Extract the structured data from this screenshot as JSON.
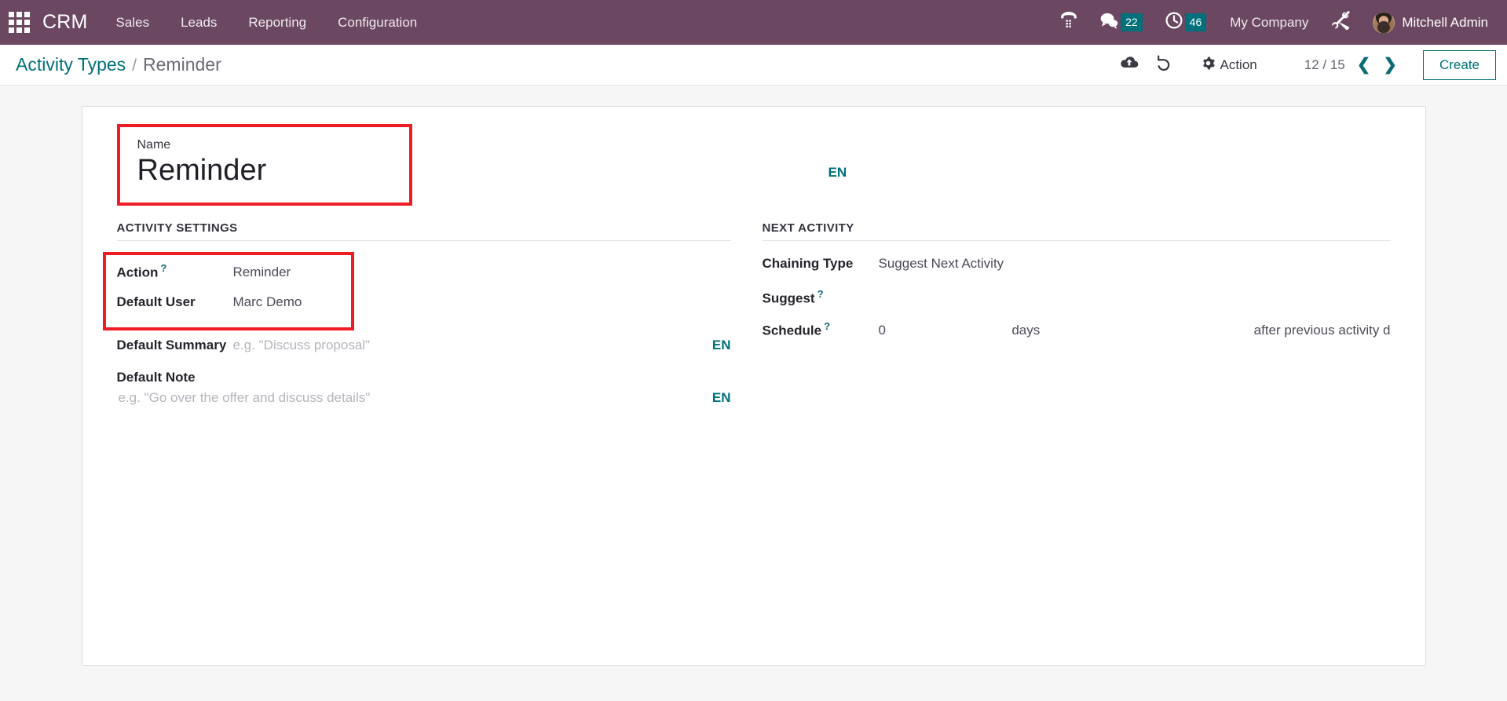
{
  "navbar": {
    "apps_icon": "apps-grid-icon",
    "brand": "CRM",
    "menu": [
      {
        "label": "Sales"
      },
      {
        "label": "Leads"
      },
      {
        "label": "Reporting"
      },
      {
        "label": "Configuration"
      }
    ],
    "voip_icon": "phone-dialpad-icon",
    "messages_icon": "chat-bubble-icon",
    "messages_count": "22",
    "activities_icon": "clock-icon",
    "activities_count": "46",
    "company": "My Company",
    "tools_icon": "wrench-screwdriver-icon",
    "user_name": "Mitchell Admin",
    "bg_color": "#6b4761",
    "badge_color": "#00707a"
  },
  "control_panel": {
    "breadcrumb_root": "Activity Types",
    "breadcrumb_sep": "/",
    "breadcrumb_current": "Reminder",
    "save_icon": "cloud-upload-icon",
    "discard_icon": "undo-icon",
    "action_icon": "gear-icon",
    "action_label": "Action",
    "pager": "12 / 15",
    "prev_icon": "chevron-left-icon",
    "next_icon": "chevron-right-icon",
    "create_label": "Create",
    "accent_color": "#00707a"
  },
  "form": {
    "name": {
      "label": "Name",
      "value": "Reminder",
      "translate_badge": "EN",
      "highlight_color": "#ee1c25"
    },
    "activity_settings": {
      "title": "ACTIVITY SETTINGS",
      "action": {
        "label": "Action",
        "help": "?",
        "value": "Reminder"
      },
      "default_user": {
        "label": "Default User",
        "value": "Marc Demo"
      },
      "default_summary": {
        "label": "Default Summary",
        "value": "",
        "placeholder": "e.g. \"Discuss proposal\"",
        "translate_badge": "EN"
      },
      "default_note": {
        "label": "Default Note",
        "value": "",
        "placeholder": "e.g. \"Go over the offer and discuss details\"",
        "translate_badge": "EN"
      }
    },
    "next_activity": {
      "title": "NEXT ACTIVITY",
      "chaining_type": {
        "label": "Chaining Type",
        "value": "Suggest Next Activity"
      },
      "suggest": {
        "label": "Suggest",
        "help": "?",
        "value": ""
      },
      "schedule": {
        "label": "Schedule",
        "help": "?",
        "value": "0",
        "unit": "days",
        "trigger": "after previous activity d"
      }
    }
  }
}
